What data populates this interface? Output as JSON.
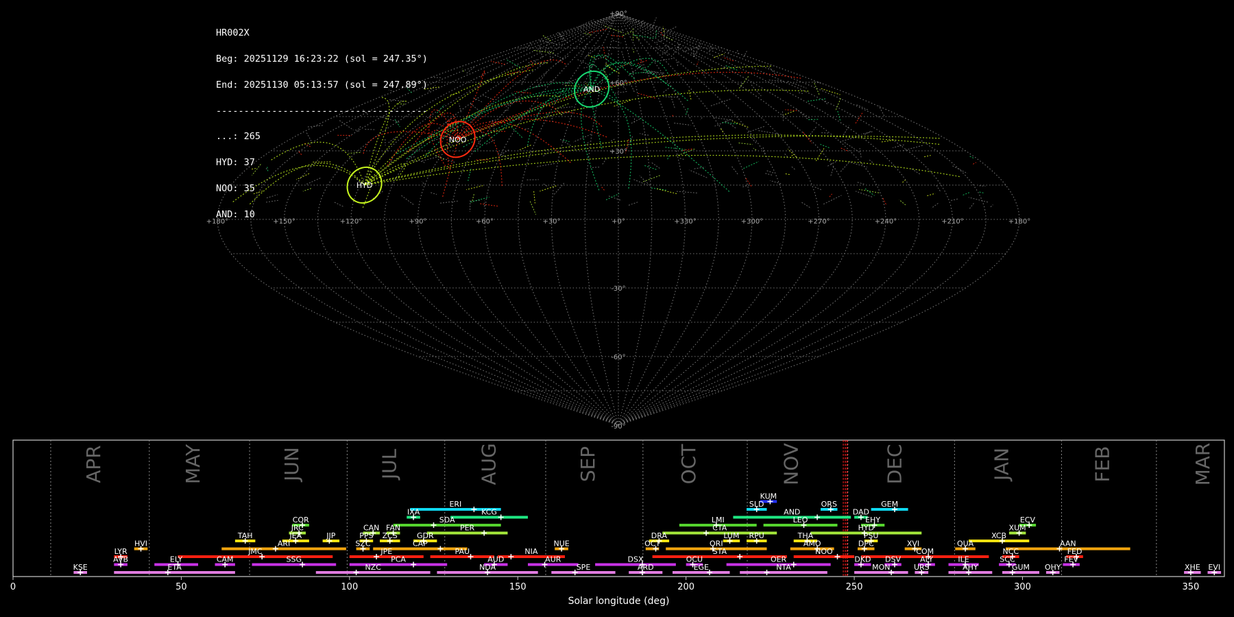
{
  "info": {
    "title": "HR002X",
    "beg": "Beg: 20251129 16:23:22 (sol = 247.35°)",
    "end": "End: 20251130 05:13:57 (sol = 247.89°)",
    "sep": "--------------------------------------",
    "counts": [
      "...: 265",
      "HYD: 37",
      "NOO: 35",
      "AND: 10"
    ]
  },
  "chart_data": [
    {
      "type": "scatter",
      "projection": "sinusoidal",
      "grid": true,
      "lon_labels": [
        "+180°",
        "+150°",
        "+120°",
        "+90°",
        "+60°",
        "+30°",
        "+0°",
        "+330°",
        "+300°",
        "+270°",
        "+240°",
        "+210°",
        "+180°"
      ],
      "lat_labels": [
        "+90°",
        "+60°",
        "+30°",
        "-30°",
        "-60°",
        "-90°"
      ],
      "showers": [
        {
          "code": "HYD",
          "lon": 118,
          "lat": 15,
          "color": "#c6f51e"
        },
        {
          "code": "NOO",
          "lon": 88,
          "lat": 35,
          "color": "#ff2b10"
        },
        {
          "code": "AND",
          "lon": 22,
          "lat": 57,
          "color": "#17d670"
        }
      ]
    },
    {
      "type": "timeline",
      "xlabel": "Solar longitude (deg)",
      "xlim": [
        0,
        360
      ],
      "xticks": [
        0,
        50,
        100,
        150,
        200,
        250,
        300,
        350
      ],
      "current_sol": [
        247.35,
        247.89
      ],
      "months": [
        {
          "name": "APR",
          "start": 11.2
        },
        {
          "name": "MAY",
          "start": 40.5
        },
        {
          "name": "JUN",
          "start": 70.3
        },
        {
          "name": "JUL",
          "start": 99.3
        },
        {
          "name": "AUG",
          "start": 128.3
        },
        {
          "name": "SEP",
          "start": 158.3
        },
        {
          "name": "OCT",
          "start": 187.2
        },
        {
          "name": "NOV",
          "start": 218.2
        },
        {
          "name": "DEC",
          "start": 248.1
        },
        {
          "name": "JAN",
          "start": 279.8
        },
        {
          "name": "FEB",
          "start": 311.6
        },
        {
          "name": "MAR",
          "start": 339.8
        }
      ],
      "showers": [
        {
          "code": "KUM",
          "row": 10,
          "start": 222,
          "end": 227,
          "peak": 225,
          "color": "#2230ff"
        },
        {
          "code": "ERI",
          "row": 9,
          "start": 118,
          "end": 145,
          "peak": 137,
          "color": "#0fd8f0"
        },
        {
          "code": "SLD",
          "row": 9,
          "start": 218,
          "end": 224,
          "peak": 221,
          "color": "#0fd8f0"
        },
        {
          "code": "ORS",
          "row": 9,
          "start": 240,
          "end": 245,
          "peak": 243,
          "color": "#0fd8f0"
        },
        {
          "code": "GEM",
          "row": 9,
          "start": 255,
          "end": 266,
          "peak": 262,
          "color": "#0fd8f0"
        },
        {
          "code": "IXA",
          "row": 8,
          "start": 117,
          "end": 121,
          "peak": 119,
          "color": "#1ee882"
        },
        {
          "code": "KCG",
          "row": 8,
          "start": 130,
          "end": 153,
          "peak": 145,
          "color": "#1ee882"
        },
        {
          "code": "AND",
          "row": 8,
          "start": 214,
          "end": 249,
          "peak": 239,
          "color": "#1ee882"
        },
        {
          "code": "DAD",
          "row": 8,
          "start": 250,
          "end": 254,
          "peak": 252,
          "color": "#1ee882"
        },
        {
          "code": "COR",
          "row": 7,
          "start": 83,
          "end": 88,
          "peak": 86,
          "color": "#55d42e"
        },
        {
          "code": "SDA",
          "row": 7,
          "start": 113,
          "end": 145,
          "peak": 125,
          "color": "#55d42e"
        },
        {
          "code": "LMI",
          "row": 7,
          "start": 198,
          "end": 221,
          "peak": 209,
          "color": "#55d42e"
        },
        {
          "code": "LEO",
          "row": 7,
          "start": 223,
          "end": 245,
          "peak": 235,
          "color": "#55d42e"
        },
        {
          "code": "EHY",
          "row": 7,
          "start": 252,
          "end": 259,
          "peak": 256,
          "color": "#55d42e"
        },
        {
          "code": "ECV",
          "row": 7,
          "start": 299,
          "end": 304,
          "peak": 302,
          "color": "#55d42e"
        },
        {
          "code": "JRC",
          "row": 6,
          "start": 82,
          "end": 87,
          "peak": 85,
          "color": "#a4e83a"
        },
        {
          "code": "CAN",
          "row": 6,
          "start": 104,
          "end": 109,
          "peak": 107,
          "color": "#a4e83a"
        },
        {
          "code": "FAN",
          "row": 6,
          "start": 111,
          "end": 115,
          "peak": 113,
          "color": "#a4e83a"
        },
        {
          "code": "PER",
          "row": 6,
          "start": 123,
          "end": 147,
          "peak": 140,
          "color": "#a4e83a"
        },
        {
          "code": "CTA",
          "row": 6,
          "start": 193,
          "end": 227,
          "peak": 206,
          "color": "#a4e83a"
        },
        {
          "code": "HYD",
          "row": 6,
          "start": 237,
          "end": 270,
          "peak": 253,
          "color": "#a4e83a"
        },
        {
          "code": "XUM",
          "row": 6,
          "start": 296,
          "end": 301,
          "peak": 299,
          "color": "#a4e83a"
        },
        {
          "code": "TAH",
          "row": 5,
          "start": 66,
          "end": 72,
          "peak": 69,
          "color": "#f0e010"
        },
        {
          "code": "JEA",
          "row": 5,
          "start": 80,
          "end": 88,
          "peak": 84,
          "color": "#f0e010"
        },
        {
          "code": "JIP",
          "row": 5,
          "start": 92,
          "end": 97,
          "peak": 94,
          "color": "#f0e010"
        },
        {
          "code": "PPS",
          "row": 5,
          "start": 103,
          "end": 107,
          "peak": 105,
          "color": "#f0e010"
        },
        {
          "code": "ZCS",
          "row": 5,
          "start": 109,
          "end": 115,
          "peak": 112,
          "color": "#f0e010"
        },
        {
          "code": "GDR",
          "row": 5,
          "start": 119,
          "end": 126,
          "peak": 122,
          "color": "#f0e010"
        },
        {
          "code": "DRA",
          "row": 5,
          "start": 189,
          "end": 195,
          "peak": 192,
          "color": "#f0e010"
        },
        {
          "code": "LUM",
          "row": 5,
          "start": 211,
          "end": 216,
          "peak": 213,
          "color": "#f0e010"
        },
        {
          "code": "RPU",
          "row": 5,
          "start": 218,
          "end": 224,
          "peak": 221,
          "color": "#f0e010"
        },
        {
          "code": "THA",
          "row": 5,
          "start": 232,
          "end": 239,
          "peak": 236,
          "color": "#f0e010"
        },
        {
          "code": "PSU",
          "row": 5,
          "start": 253,
          "end": 257,
          "peak": 255,
          "color": "#f0e010"
        },
        {
          "code": "XCB",
          "row": 5,
          "start": 284,
          "end": 302,
          "peak": 294,
          "color": "#f0e010"
        },
        {
          "code": "HVI",
          "row": 4,
          "start": 36,
          "end": 40,
          "peak": 38,
          "color": "#f5a60e"
        },
        {
          "code": "ARI",
          "row": 4,
          "start": 62,
          "end": 99,
          "peak": 78,
          "color": "#f5a60e"
        },
        {
          "code": "SZC",
          "row": 4,
          "start": 102,
          "end": 106,
          "peak": 104,
          "color": "#f5a60e"
        },
        {
          "code": "CAP",
          "row": 4,
          "start": 107,
          "end": 135,
          "peak": 127,
          "color": "#f5a60e"
        },
        {
          "code": "NUE",
          "row": 4,
          "start": 161,
          "end": 165,
          "peak": 163,
          "color": "#f5a60e"
        },
        {
          "code": "OCT",
          "row": 4,
          "start": 188,
          "end": 192,
          "peak": 191,
          "color": "#f5a60e"
        },
        {
          "code": "ORI",
          "row": 4,
          "start": 194,
          "end": 224,
          "peak": 208,
          "color": "#f5a60e"
        },
        {
          "code": "AMO",
          "row": 4,
          "start": 231,
          "end": 244,
          "peak": 239,
          "color": "#f5a60e"
        },
        {
          "code": "DPC",
          "row": 4,
          "start": 251,
          "end": 256,
          "peak": 253,
          "color": "#f5a60e"
        },
        {
          "code": "XVI",
          "row": 4,
          "start": 265,
          "end": 270,
          "peak": 268,
          "color": "#f5a60e"
        },
        {
          "code": "QUA",
          "row": 4,
          "start": 280,
          "end": 286,
          "peak": 283,
          "color": "#f5a60e"
        },
        {
          "code": "AAN",
          "row": 4,
          "start": 295,
          "end": 332,
          "peak": 311,
          "color": "#f5a60e"
        },
        {
          "code": "LYR",
          "row": 3,
          "start": 30,
          "end": 34,
          "peak": 32,
          "color": "#ff2010"
        },
        {
          "code": "JMC",
          "row": 3,
          "start": 49,
          "end": 95,
          "peak": 74,
          "color": "#ff2010"
        },
        {
          "code": "JPE",
          "row": 3,
          "start": 100,
          "end": 122,
          "peak": 108,
          "color": "#ff2010"
        },
        {
          "code": "PAU",
          "row": 3,
          "start": 124,
          "end": 143,
          "peak": 136,
          "color": "#ff2010"
        },
        {
          "code": "NIA",
          "row": 3,
          "start": 144,
          "end": 164,
          "peak": 148,
          "color": "#ff2010"
        },
        {
          "code": "STA",
          "row": 3,
          "start": 190,
          "end": 230,
          "peak": 216,
          "color": "#ff2010"
        },
        {
          "code": "NOO",
          "row": 3,
          "start": 232,
          "end": 250,
          "peak": 245,
          "color": "#ff2010"
        },
        {
          "code": "COM",
          "row": 3,
          "start": 252,
          "end": 290,
          "peak": 272,
          "color": "#ff2010"
        },
        {
          "code": "NCC",
          "row": 3,
          "start": 294,
          "end": 299,
          "peak": 297,
          "color": "#ff2010"
        },
        {
          "code": "FED",
          "row": 3,
          "start": 313,
          "end": 318,
          "peak": 316,
          "color": "#ff2010"
        },
        {
          "code": "AVB",
          "row": 2,
          "start": 30,
          "end": 34,
          "peak": 32,
          "color": "#c832e6"
        },
        {
          "code": "ELY",
          "row": 2,
          "start": 42,
          "end": 55,
          "peak": 49,
          "color": "#c832e6"
        },
        {
          "code": "CAM",
          "row": 2,
          "start": 60,
          "end": 66,
          "peak": 63,
          "color": "#c832e6"
        },
        {
          "code": "SSG",
          "row": 2,
          "start": 71,
          "end": 96,
          "peak": 86,
          "color": "#c832e6"
        },
        {
          "code": "PCA",
          "row": 2,
          "start": 100,
          "end": 129,
          "peak": 119,
          "color": "#c832e6"
        },
        {
          "code": "AUD",
          "row": 2,
          "start": 140,
          "end": 147,
          "peak": 143,
          "color": "#c832e6"
        },
        {
          "code": "AUR",
          "row": 2,
          "start": 153,
          "end": 168,
          "peak": 158,
          "color": "#c832e6"
        },
        {
          "code": "DSX",
          "row": 2,
          "start": 173,
          "end": 197,
          "peak": 187,
          "color": "#c832e6"
        },
        {
          "code": "OCU",
          "row": 2,
          "start": 200,
          "end": 205,
          "peak": 202,
          "color": "#c832e6"
        },
        {
          "code": "OER",
          "row": 2,
          "start": 212,
          "end": 243,
          "peak": 232,
          "color": "#c832e6"
        },
        {
          "code": "DKD",
          "row": 2,
          "start": 250,
          "end": 255,
          "peak": 252,
          "color": "#c832e6"
        },
        {
          "code": "DSV",
          "row": 2,
          "start": 259,
          "end": 264,
          "peak": 262,
          "color": "#c832e6"
        },
        {
          "code": "ALY",
          "row": 2,
          "start": 269,
          "end": 274,
          "peak": 272,
          "color": "#c832e6"
        },
        {
          "code": "ILE",
          "row": 2,
          "start": 278,
          "end": 287,
          "peak": 283,
          "color": "#c832e6"
        },
        {
          "code": "SCC",
          "row": 2,
          "start": 293,
          "end": 298,
          "peak": 296,
          "color": "#c832e6"
        },
        {
          "code": "FEV",
          "row": 2,
          "start": 312,
          "end": 317,
          "peak": 315,
          "color": "#c832e6"
        },
        {
          "code": "KSE",
          "row": 1,
          "start": 18,
          "end": 22,
          "peak": 20,
          "color": "#e07ce0"
        },
        {
          "code": "ETA",
          "row": 1,
          "start": 30,
          "end": 66,
          "peak": 46,
          "color": "#e07ce0"
        },
        {
          "code": "NZC",
          "row": 1,
          "start": 90,
          "end": 124,
          "peak": 102,
          "color": "#e07ce0"
        },
        {
          "code": "NDA",
          "row": 1,
          "start": 126,
          "end": 156,
          "peak": 141,
          "color": "#e07ce0"
        },
        {
          "code": "SPE",
          "row": 1,
          "start": 160,
          "end": 179,
          "peak": 167,
          "color": "#e07ce0"
        },
        {
          "code": "ARD",
          "row": 1,
          "start": 183,
          "end": 193,
          "peak": 187,
          "color": "#e07ce0"
        },
        {
          "code": "EGE",
          "row": 1,
          "start": 196,
          "end": 213,
          "peak": 207,
          "color": "#e07ce0"
        },
        {
          "code": "NTA",
          "row": 1,
          "start": 216,
          "end": 242,
          "peak": 224,
          "color": "#e07ce0"
        },
        {
          "code": "MON",
          "row": 1,
          "start": 250,
          "end": 266,
          "peak": 261,
          "color": "#e07ce0"
        },
        {
          "code": "URS",
          "row": 1,
          "start": 268,
          "end": 272,
          "peak": 270,
          "color": "#e07ce0"
        },
        {
          "code": "AHY",
          "row": 1,
          "start": 278,
          "end": 291,
          "peak": 284,
          "color": "#e07ce0"
        },
        {
          "code": "GUM",
          "row": 1,
          "start": 294,
          "end": 305,
          "peak": 297,
          "color": "#e07ce0"
        },
        {
          "code": "OHY",
          "row": 1,
          "start": 307,
          "end": 311,
          "peak": 309,
          "color": "#e07ce0"
        },
        {
          "code": "XHE",
          "row": 1,
          "start": 348,
          "end": 353,
          "peak": 350,
          "color": "#e07ce0"
        },
        {
          "code": "EVI",
          "row": 1,
          "start": 355,
          "end": 359,
          "peak": 357,
          "color": "#e07ce0"
        }
      ]
    }
  ]
}
